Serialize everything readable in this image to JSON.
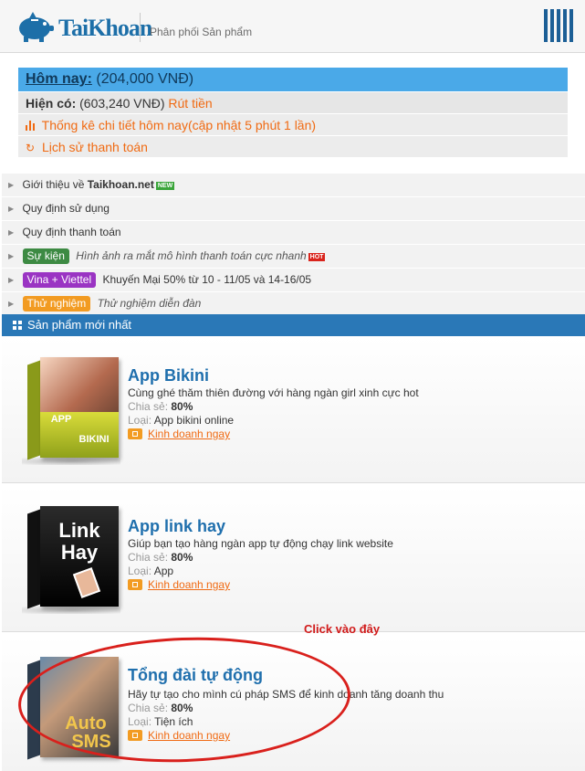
{
  "header": {
    "logo_text": "TaiKhoan",
    "subtitle": "Phân phối Sản phẩm",
    "menu_icon": "menu-bars-icon"
  },
  "summary": {
    "today_label": "Hôm nay:",
    "today_value": "(204,000 VNĐ)",
    "current_label": "Hiện có:",
    "current_value": "(603,240 VNĐ)",
    "withdraw_label": "Rút tiền",
    "stats_label": "Thống kê chi tiết hôm nay(cập nhật 5 phút 1 lần)",
    "history_label": "Lịch sử thanh toán"
  },
  "info_rows": [
    {
      "text_before": "Giới thiệu về ",
      "bold": "Taikhoan.net",
      "badge": "NEW"
    },
    {
      "text": "Quy định sử dụng"
    },
    {
      "text": "Quy định thanh toán"
    },
    {
      "tag": "Sự kiện",
      "text": "Hình ảnh ra mắt mô hình thanh toán cực nhanh",
      "badge": "HOT"
    },
    {
      "tag": "Vina + Viettel",
      "text": "Khuyến Mại 50% từ 10 - 11/05 và 14-16/05"
    },
    {
      "tag": "Thử nghiệm",
      "text": "Thử nghiệm diễn đàn"
    }
  ],
  "section": {
    "title": "Sản phẩm mới nhất"
  },
  "products": [
    {
      "title": "App Bikini",
      "desc": "Cùng ghé thăm thiên đường với hàng ngàn girl xinh cực hot",
      "share_label": "Chia sẻ:",
      "share_value": "80%",
      "type_label": "Loại:",
      "type_value": "App bikini online",
      "link": "Kinh doanh ngay",
      "box_text_1": "APP",
      "box_text_2": "BIKINI"
    },
    {
      "title": "App link hay",
      "desc": "Giúp bạn tạo hàng ngàn app tự động chạy link website",
      "share_label": "Chia sẻ:",
      "share_value": "80%",
      "type_label": "Loại:",
      "type_value": "App",
      "link": "Kinh doanh ngay",
      "box_text_1": "Link",
      "box_text_2": "Hay"
    },
    {
      "title": "Tổng đài tự động",
      "desc": "Hãy tự tạo cho mình cú pháp SMS để kinh doanh tăng doanh thu",
      "share_label": "Chia sẻ:",
      "share_value": "80%",
      "type_label": "Loại:",
      "type_value": "Tiện ích",
      "link": "Kinh doanh ngay",
      "box_text_1": "Auto",
      "box_text_2": "SMS"
    }
  ],
  "annotation": {
    "click_here": "Click vào đây"
  },
  "colors": {
    "brand_blue": "#1f6fad",
    "summary_blue": "#4aa9e8",
    "link_orange": "#f06a12",
    "annotation_red": "#d9201c"
  }
}
